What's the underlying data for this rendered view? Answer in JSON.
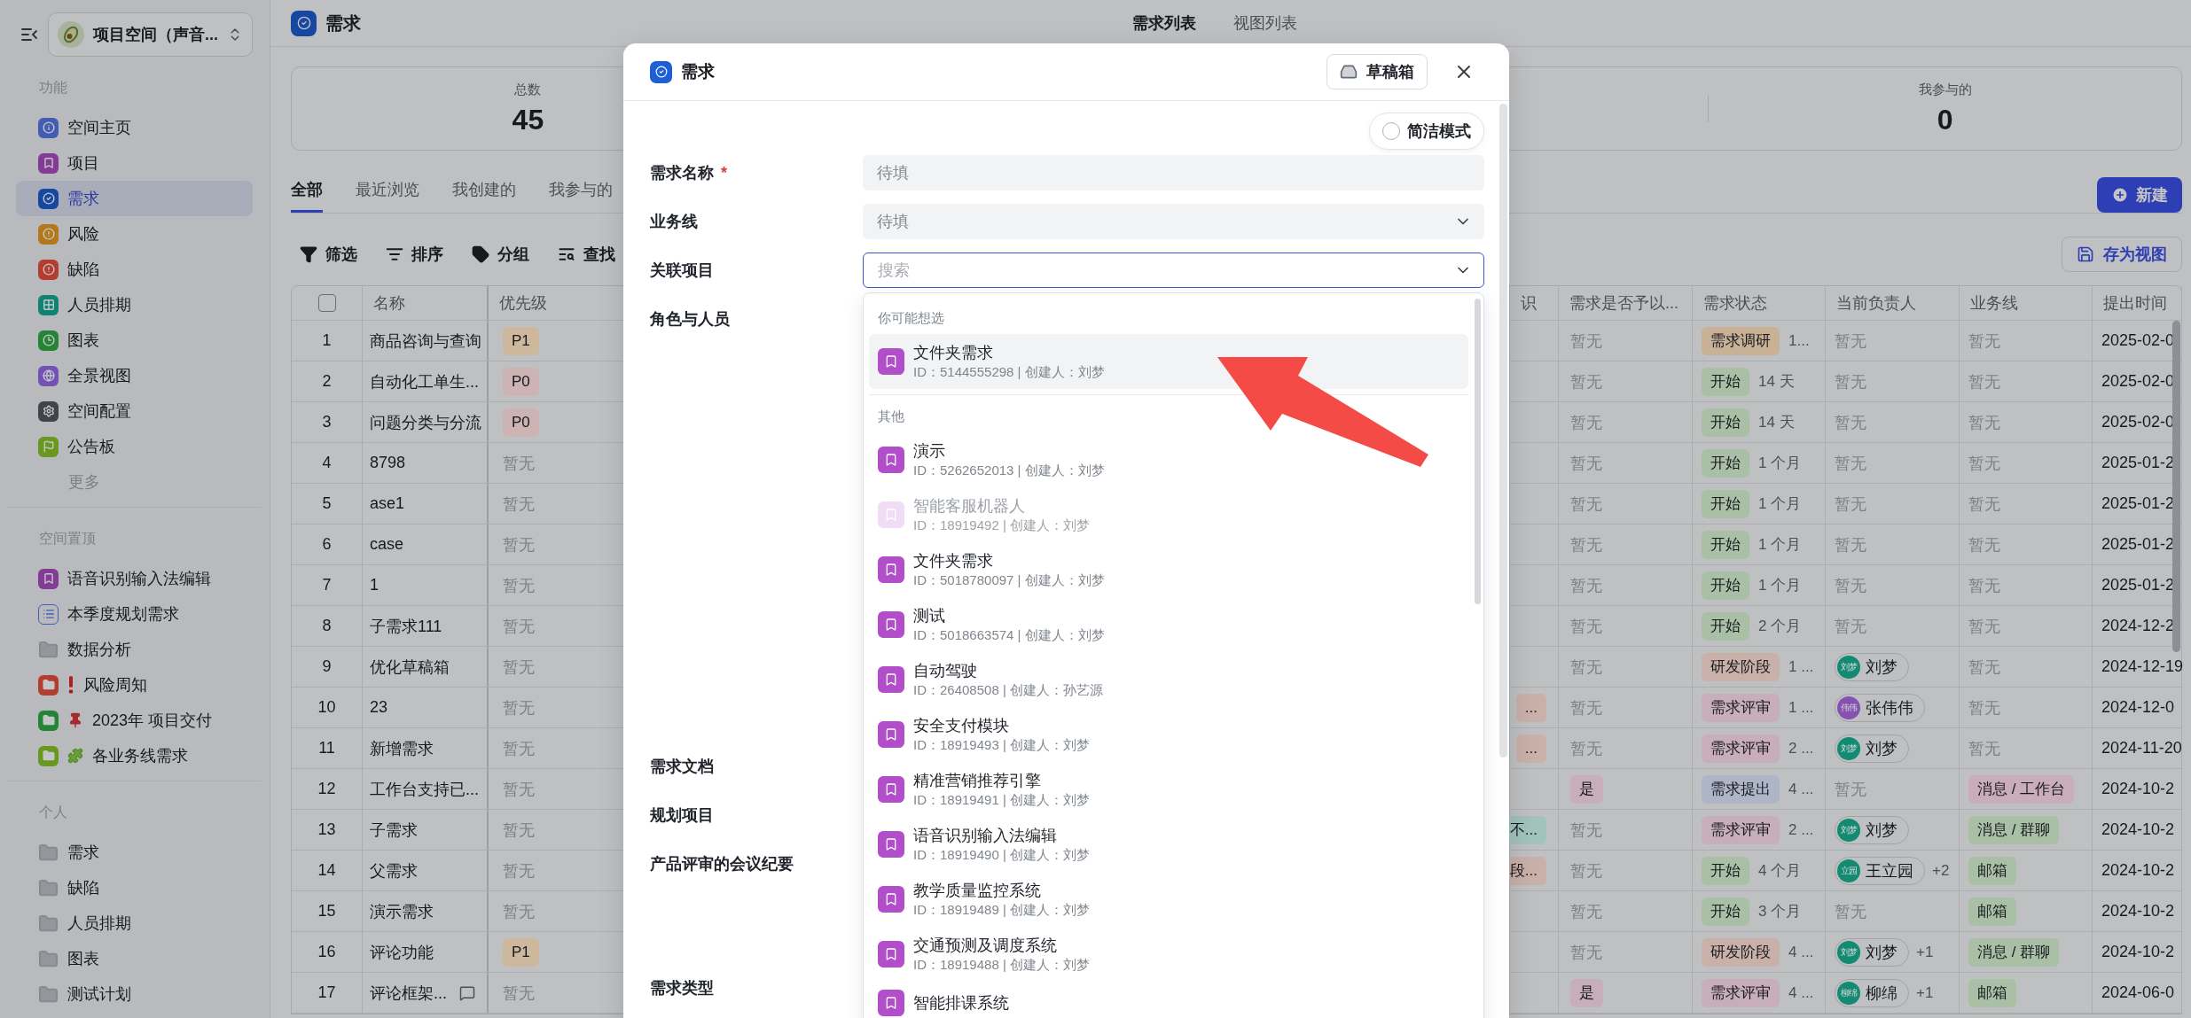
{
  "sidebar": {
    "workspace": {
      "name": "项目空间（声音..."
    },
    "sections": [
      {
        "title": "功能",
        "items": [
          {
            "label": "空间主页",
            "selected": false
          },
          {
            "label": "项目",
            "selected": false
          },
          {
            "label": "需求",
            "selected": true
          },
          {
            "label": "风险",
            "selected": false
          },
          {
            "label": "缺陷",
            "selected": false
          },
          {
            "label": "人员排期",
            "selected": false
          },
          {
            "label": "图表",
            "selected": false
          },
          {
            "label": "全景视图",
            "selected": false
          },
          {
            "label": "空间配置",
            "selected": false
          },
          {
            "label": "公告板",
            "selected": false
          }
        ],
        "more": "更多"
      },
      {
        "title": "空间置顶",
        "items": [
          {
            "label": "语音识别输入法编辑",
            "selected": false
          },
          {
            "label": "本季度规划需求",
            "selected": false
          },
          {
            "label": "数据分析",
            "selected": false
          },
          {
            "label": "风险周知",
            "selected": false
          },
          {
            "label": "2023年 项目交付",
            "selected": false
          },
          {
            "label": "各业务线需求",
            "selected": false
          }
        ]
      },
      {
        "title": "个人",
        "items": [
          {
            "label": "需求",
            "selected": false
          },
          {
            "label": "缺陷",
            "selected": false
          },
          {
            "label": "人员排期",
            "selected": false
          },
          {
            "label": "图表",
            "selected": false
          },
          {
            "label": "测试计划",
            "selected": false
          }
        ]
      }
    ]
  },
  "main": {
    "header": {
      "title": "需求",
      "tabs": [
        {
          "label": "需求列表",
          "selected": true
        },
        {
          "label": "视图列表",
          "selected": false
        }
      ]
    },
    "stats": [
      {
        "label": "总数",
        "value": "45"
      },
      {
        "label": "我参与的",
        "value": "0"
      }
    ],
    "tabs": [
      {
        "label": "全部",
        "selected": true
      },
      {
        "label": "最近浏览",
        "selected": false
      },
      {
        "label": "我创建的",
        "selected": false
      },
      {
        "label": "我参与的",
        "selected": false
      }
    ],
    "new_button": "新建",
    "toolbar": [
      "筛选",
      "排序",
      "分组",
      "查找"
    ],
    "save_view_button": "存为视图",
    "table": {
      "select_all_checked": false,
      "columns": [
        "名称",
        "优先级",
        "识",
        "需求是否予以...",
        "需求状态",
        "当前负责人",
        "业务线",
        "提出时间"
      ],
      "rows": [
        {
          "index": "1",
          "name": "商品咨询与查询",
          "comment": false,
          "priority": {
            "text": "P1",
            "color": "#cdb89d"
          },
          "approved": {
            "text": "暂无"
          },
          "status": {
            "text": "需求调研",
            "color": "#c9b196"
          },
          "duration": "1...",
          "owner": {
            "kind": "empty",
            "text": "暂无"
          },
          "business_line": {
            "text": "暂无"
          },
          "date": "2025-02-0"
        },
        {
          "index": "2",
          "name": "自动化工单生...",
          "comment": false,
          "priority": {
            "text": "P0",
            "color": "#cdb3b3"
          },
          "approved": {
            "text": "暂无"
          },
          "status": {
            "text": "开始",
            "color": "#a9c0a6"
          },
          "duration": "14 天",
          "owner": {
            "kind": "empty",
            "text": "暂无"
          },
          "business_line": {
            "text": "暂无"
          },
          "date": "2025-02-0"
        },
        {
          "index": "3",
          "name": "问题分类与分流",
          "comment": false,
          "priority": {
            "text": "P0",
            "color": "#cdb3b3"
          },
          "approved": {
            "text": "暂无"
          },
          "status": {
            "text": "开始",
            "color": "#a9c0a6"
          },
          "duration": "14 天",
          "owner": {
            "kind": "empty",
            "text": "暂无"
          },
          "business_line": {
            "text": "暂无"
          },
          "date": "2025-02-0"
        },
        {
          "index": "4",
          "name": "8798",
          "comment": false,
          "priority": {
            "text": "暂无"
          },
          "approved": {
            "text": "暂无"
          },
          "status": {
            "text": "开始",
            "color": "#a9c0a6"
          },
          "duration": "1 个月",
          "owner": {
            "kind": "empty",
            "text": "暂无"
          },
          "business_line": {
            "text": "暂无"
          },
          "date": "2025-01-2"
        },
        {
          "index": "5",
          "name": "ase1",
          "comment": false,
          "priority": {
            "text": "暂无"
          },
          "approved": {
            "text": "暂无"
          },
          "status": {
            "text": "开始",
            "color": "#a9c0a6"
          },
          "duration": "1 个月",
          "owner": {
            "kind": "empty",
            "text": "暂无"
          },
          "business_line": {
            "text": "暂无"
          },
          "date": "2025-01-2"
        },
        {
          "index": "6",
          "name": "case",
          "comment": false,
          "priority": {
            "text": "暂无"
          },
          "approved": {
            "text": "暂无"
          },
          "status": {
            "text": "开始",
            "color": "#a9c0a6"
          },
          "duration": "1 个月",
          "owner": {
            "kind": "empty",
            "text": "暂无"
          },
          "business_line": {
            "text": "暂无"
          },
          "date": "2025-01-2"
        },
        {
          "index": "7",
          "name": "1",
          "comment": false,
          "priority": {
            "text": "暂无"
          },
          "approved": {
            "text": "暂无"
          },
          "status": {
            "text": "开始",
            "color": "#a9c0a6"
          },
          "duration": "1 个月",
          "owner": {
            "kind": "empty",
            "text": "暂无"
          },
          "business_line": {
            "text": "暂无"
          },
          "date": "2025-01-2"
        },
        {
          "index": "8",
          "name": "子需求111",
          "comment": false,
          "priority": {
            "text": "暂无"
          },
          "approved": {
            "text": "暂无"
          },
          "status": {
            "text": "开始",
            "color": "#a9c0a6"
          },
          "duration": "2 个月",
          "owner": {
            "kind": "empty",
            "text": "暂无"
          },
          "business_line": {
            "text": "暂无"
          },
          "date": "2024-12-2"
        },
        {
          "index": "9",
          "name": "优化草稿箱",
          "comment": false,
          "priority": {
            "text": "暂无"
          },
          "approved": {
            "text": "暂无"
          },
          "status": {
            "text": "研发阶段",
            "color": "#c9b0a8"
          },
          "duration": "1 ...",
          "owner": {
            "kind": "person",
            "name": "刘梦",
            "avatar": "刘梦",
            "color": "#138a72"
          },
          "business_line": {
            "text": "暂无"
          },
          "date": "2024-12-19"
        },
        {
          "index": "10",
          "name": "23",
          "comment": false,
          "priority": {
            "text": "暂无"
          },
          "column_3": {
            "text": "...",
            "color": "#c9b0a8"
          },
          "approved": {
            "text": "暂无"
          },
          "status": {
            "text": "需求评审",
            "color": "#c8aebb"
          },
          "duration": "1 ...",
          "owner": {
            "kind": "person",
            "name": "张伟伟",
            "avatar": "伟伟",
            "color": "#8552b0"
          },
          "business_line": {
            "text": "暂无"
          },
          "date": "2024-12-0"
        },
        {
          "index": "11",
          "name": "新增需求",
          "comment": false,
          "priority": {
            "text": "暂无"
          },
          "column_3": {
            "text": "...",
            "color": "#c9b0a8"
          },
          "approved": {
            "text": "暂无"
          },
          "status": {
            "text": "需求评审",
            "color": "#c8aebb"
          },
          "duration": "2 ...",
          "owner": {
            "kind": "person",
            "name": "刘梦",
            "avatar": "刘梦",
            "color": "#138a72"
          },
          "business_line": {
            "text": "暂无"
          },
          "date": "2024-11-20"
        },
        {
          "index": "12",
          "name": "工作台支持已...",
          "comment": false,
          "priority": {
            "text": "暂无"
          },
          "approved": {
            "text": "是",
            "color": "#c8aebb"
          },
          "status": {
            "text": "需求提出",
            "color": "#aeb5c7"
          },
          "duration": "4 ...",
          "owner": {
            "kind": "empty",
            "text": "暂无"
          },
          "business_line": {
            "text": "消息 / 工作台",
            "color": "#caadbb"
          },
          "date": "2024-10-2"
        },
        {
          "index": "13",
          "name": "子需求",
          "comment": false,
          "priority": {
            "text": "暂无"
          },
          "column_3": {
            "text": "不...",
            "color": "#a2c2bc"
          },
          "approved": {
            "text": "暂无"
          },
          "status": {
            "text": "需求评审",
            "color": "#c8aebb"
          },
          "duration": "2 ...",
          "owner": {
            "kind": "person",
            "name": "刘梦",
            "avatar": "刘梦",
            "color": "#138a72"
          },
          "business_line": {
            "text": "消息 / 群聊",
            "color": "#a9c0a6"
          },
          "date": "2024-10-2"
        },
        {
          "index": "14",
          "name": "父需求",
          "comment": false,
          "priority": {
            "text": "暂无"
          },
          "column_3": {
            "text": "段...",
            "color": "#c9b0a8"
          },
          "approved": {
            "text": "暂无"
          },
          "status": {
            "text": "开始",
            "color": "#a9c0a6"
          },
          "duration": "4 个月",
          "owner": {
            "kind": "person",
            "name": "王立园",
            "avatar": "立园",
            "color": "#138a72",
            "extra": "+2"
          },
          "business_line": {
            "text": "邮箱",
            "color": "#a9c0a6"
          },
          "date": "2024-10-2"
        },
        {
          "index": "15",
          "name": "演示需求",
          "comment": false,
          "priority": {
            "text": "暂无"
          },
          "approved": {
            "text": "暂无"
          },
          "status": {
            "text": "开始",
            "color": "#a9c0a6"
          },
          "duration": "3 个月",
          "owner": {
            "kind": "empty",
            "text": "暂无"
          },
          "business_line": {
            "text": "邮箱",
            "color": "#a9c0a6"
          },
          "date": "2024-10-2"
        },
        {
          "index": "16",
          "name": "评论功能",
          "comment": false,
          "priority": {
            "text": "P1",
            "color": "#cdb89d"
          },
          "approved": {
            "text": "暂无"
          },
          "status": {
            "text": "研发阶段",
            "color": "#c9b0a8"
          },
          "duration": "4 ...",
          "owner": {
            "kind": "person",
            "name": "刘梦",
            "avatar": "刘梦",
            "color": "#138a72",
            "extra": "+1"
          },
          "business_line": {
            "text": "消息 / 群聊",
            "color": "#a9c0a6"
          },
          "date": "2024-10-2"
        },
        {
          "index": "17",
          "name": "评论框架...",
          "comment": true,
          "priority": {
            "text": "暂无"
          },
          "approved": {
            "text": "是",
            "color": "#c8aebb"
          },
          "status": {
            "text": "需求评审",
            "color": "#c8aebb"
          },
          "duration": "4 ...",
          "owner": {
            "kind": "person",
            "name": "柳绵",
            "avatar": "柳绵",
            "color": "#138a72",
            "extra": "+1"
          },
          "business_line": {
            "text": "邮箱",
            "color": "#a9c0a6"
          },
          "date": "2024-06-0"
        }
      ]
    }
  },
  "modal": {
    "title": "需求",
    "draft_button": "草稿箱",
    "compact_mode": {
      "label": "简洁模式",
      "on": false
    },
    "fields": [
      {
        "label": "需求名称",
        "required_mark": "*",
        "kind": "text",
        "placeholder": "待填"
      },
      {
        "label": "业务线",
        "kind": "select",
        "placeholder": "待填"
      },
      {
        "label": "关联项目",
        "kind": "search",
        "placeholder": "搜索"
      },
      {
        "label": "角色与人员"
      },
      {
        "label": "需求文档"
      },
      {
        "label": "规划项目"
      },
      {
        "label": "产品评审的会议纪要"
      },
      {
        "label": "需求类型"
      }
    ],
    "dropdown": {
      "sections": [
        {
          "title": "你可能想选",
          "items": [
            {
              "title": "文件夹需求",
              "meta": "ID：5144555298 | 创建人：刘梦",
              "highlighted": true,
              "disabled": false
            }
          ]
        },
        {
          "title": "其他",
          "items": [
            {
              "title": "演示",
              "meta": "ID：5262652013 | 创建人：刘梦",
              "highlighted": false,
              "disabled": false
            },
            {
              "title": "智能客服机器人",
              "meta": "ID：18919492 | 创建人：刘梦",
              "highlighted": false,
              "disabled": true
            },
            {
              "title": "文件夹需求",
              "meta": "ID：5018780097 | 创建人：刘梦",
              "highlighted": false,
              "disabled": false
            },
            {
              "title": "测试",
              "meta": "ID：5018663574 | 创建人：刘梦",
              "highlighted": false,
              "disabled": false
            },
            {
              "title": "自动驾驶",
              "meta": "ID：26408508 | 创建人：孙艺源",
              "highlighted": false,
              "disabled": false
            },
            {
              "title": "安全支付模块",
              "meta": "ID：18919493 | 创建人：刘梦",
              "highlighted": false,
              "disabled": false
            },
            {
              "title": "精准营销推荐引擎",
              "meta": "ID：18919491 | 创建人：刘梦",
              "highlighted": false,
              "disabled": false
            },
            {
              "title": "语音识别输入法编辑",
              "meta": "ID：18919490 | 创建人：刘梦",
              "highlighted": false,
              "disabled": false
            },
            {
              "title": "教学质量监控系统",
              "meta": "ID：18919489 | 创建人：刘梦",
              "highlighted": false,
              "disabled": false
            },
            {
              "title": "交通预测及调度系统",
              "meta": "ID：18919488 | 创建人：刘梦",
              "highlighted": false,
              "disabled": false
            },
            {
              "title": "智能排课系统",
              "highlighted": false,
              "disabled": false
            }
          ]
        }
      ]
    }
  }
}
